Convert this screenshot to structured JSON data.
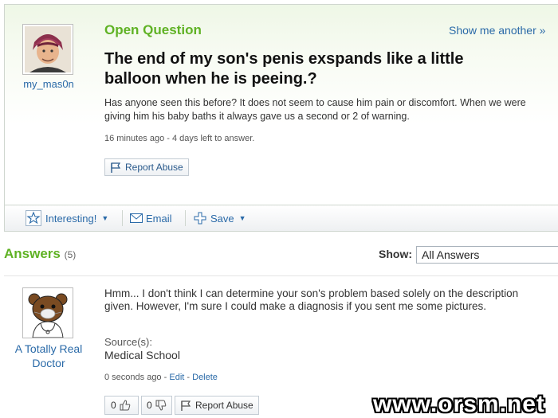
{
  "question": {
    "label": "Open Question",
    "show_another": "Show me another »",
    "username": "my_mas0n",
    "title": "The end of my son's penis exspands like a little balloon when he is peeing.?",
    "body": "Has anyone seen this before? It does not seem to cause him pain or discomfort. When we were giving him his baby baths it always gave us a second or 2 of warning.",
    "meta": "16 minutes ago - 4 days left to answer.",
    "report_label": "Report Abuse"
  },
  "toolbar": {
    "interesting_label": "Interesting!",
    "email_label": "Email",
    "save_label": "Save"
  },
  "answers": {
    "title": "Answers",
    "count": "(5)",
    "show_label": "Show:",
    "show_selected": "All Answers"
  },
  "answer": {
    "author": "A Totally Real Doctor",
    "body": "Hmm... I don't think I can determine your son's problem based solely on the description given. However, I'm sure I could make a diagnosis if you sent me some pictures.",
    "source_label": "Source(s):",
    "source_value": "Medical School",
    "time": "0 seconds ago",
    "sep": "-",
    "edit_label": "Edit",
    "delete_label": "Delete",
    "thumbs_up_count": "0",
    "thumbs_down_count": "0",
    "report_label": "Report Abuse"
  },
  "watermark": "www.orsm.net",
  "colors": {
    "accent_green": "#5fb224",
    "link_blue": "#2a6aa8"
  }
}
